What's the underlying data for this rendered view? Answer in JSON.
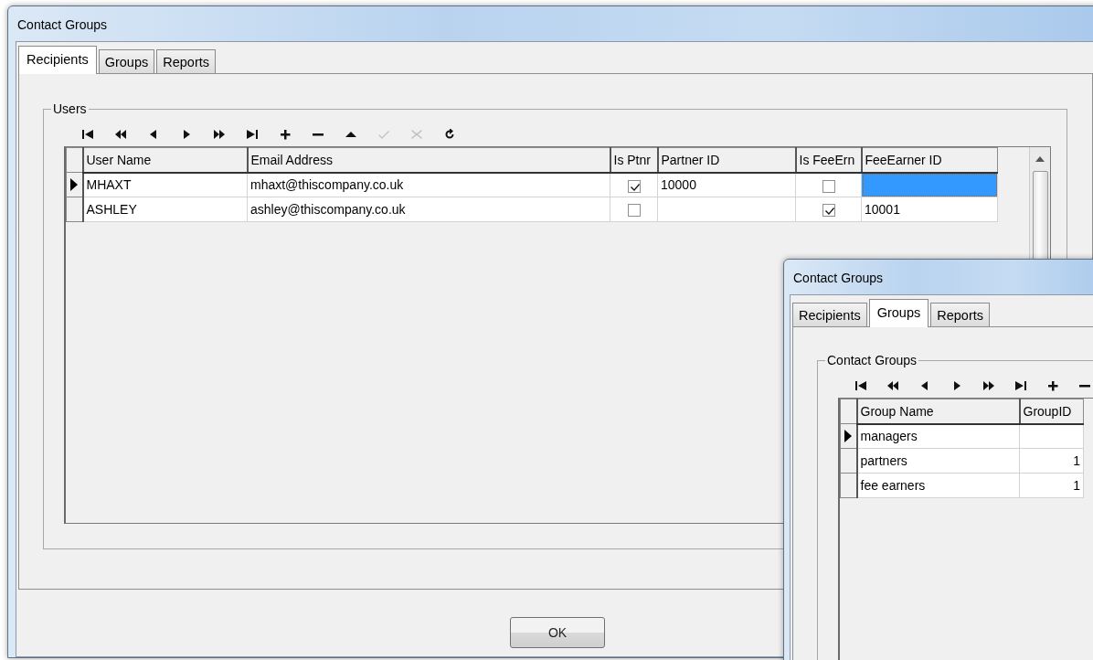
{
  "main_window": {
    "title": "Contact Groups",
    "tabs": [
      {
        "label": "Recipients",
        "selected": true
      },
      {
        "label": "Groups",
        "selected": false
      },
      {
        "label": "Reports",
        "selected": false
      }
    ],
    "users": {
      "legend": "Users",
      "navigator": [
        {
          "kind": "first",
          "disabled": false
        },
        {
          "kind": "prior_page",
          "disabled": false
        },
        {
          "kind": "prior",
          "disabled": false
        },
        {
          "kind": "next",
          "disabled": false
        },
        {
          "kind": "next_page",
          "disabled": false
        },
        {
          "kind": "last",
          "disabled": false
        },
        {
          "kind": "insert",
          "disabled": false
        },
        {
          "kind": "delete",
          "disabled": false
        },
        {
          "kind": "edit",
          "disabled": false
        },
        {
          "kind": "post",
          "disabled": true
        },
        {
          "kind": "cancel",
          "disabled": true
        },
        {
          "kind": "refresh",
          "disabled": false
        }
      ],
      "columns": [
        "User Name",
        "Email Address",
        "Is Ptnr",
        "Partner ID",
        "Is FeeErn",
        "FeeEarner ID"
      ],
      "rows": [
        {
          "selected": true,
          "user_name": "MHAXT",
          "email": "mhaxt@thiscompany.co.uk",
          "is_partner": true,
          "partner_id": "10000",
          "is_fee_earner": false,
          "fee_earner_id_selected": true
        },
        {
          "selected": false,
          "user_name": "ASHLEY",
          "email": "ashley@thiscompany.co.uk",
          "is_partner": false,
          "is_fee_earner": true,
          "fee_earner_id": "10001",
          "fee_earner_id_selected": false
        }
      ]
    },
    "ok_button": "OK"
  },
  "second_window": {
    "title": "Contact Groups",
    "tabs": [
      {
        "label": "Recipients",
        "selected": false
      },
      {
        "label": "Groups",
        "selected": true
      },
      {
        "label": "Reports",
        "selected": false
      }
    ],
    "groups": {
      "legend": "Contact Groups",
      "navigator": [
        {
          "kind": "first",
          "disabled": false
        },
        {
          "kind": "prior_page",
          "disabled": false
        },
        {
          "kind": "prior",
          "disabled": false
        },
        {
          "kind": "next",
          "disabled": false
        },
        {
          "kind": "next_page",
          "disabled": false
        },
        {
          "kind": "last",
          "disabled": false
        },
        {
          "kind": "insert",
          "disabled": false
        },
        {
          "kind": "delete",
          "disabled": false
        }
      ],
      "columns": [
        "Group Name",
        "GroupID"
      ],
      "rows": [
        {
          "selected": true,
          "group_name": "managers"
        },
        {
          "selected": false,
          "group_name": "partners",
          "group_id": "1"
        },
        {
          "selected": false,
          "group_name": "fee earners",
          "group_id": "1"
        }
      ]
    }
  }
}
